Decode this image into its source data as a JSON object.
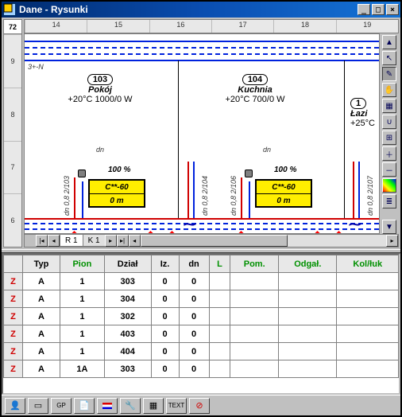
{
  "title": "Dane - Rysunki",
  "topruler_start_label": "72",
  "topruler": [
    "14",
    "15",
    "16",
    "17",
    "18",
    "19"
  ],
  "leftruler": [
    "9",
    "8",
    "7",
    "6"
  ],
  "wall_label": "3+-N",
  "rooms": [
    {
      "num": "103",
      "name": "Pokój",
      "cond": "+20°C 1000/0 W"
    },
    {
      "num": "104",
      "name": "Kuchnia",
      "cond": "+20°C 700/0 W"
    },
    {
      "num": "1",
      "name": "Łazi",
      "cond": "+25°C "
    }
  ],
  "dn_label": "dn",
  "pct_label": "100 %",
  "radiator": {
    "model": "C**-60",
    "len": "0 m"
  },
  "vlabels": [
    "dn 0,8  2/103",
    "dn 0,8  2/104",
    "dn 0,8  2/106",
    "dn 0,8  2/107"
  ],
  "sheet_tabs": [
    "R 1",
    "K 1"
  ],
  "table": {
    "headers": [
      "",
      "Typ",
      "Pion",
      "Dział",
      "Iz.",
      "dn",
      "L",
      "Pom.",
      "Odgał.",
      "Kol/łuk"
    ],
    "green_cols": [
      2,
      6,
      7,
      8,
      9
    ],
    "rows": [
      [
        "Z",
        "A",
        "1",
        "303",
        "0",
        "0",
        "",
        "",
        "",
        ""
      ],
      [
        "Z",
        "A",
        "1",
        "304",
        "0",
        "0",
        "",
        "",
        "",
        ""
      ],
      [
        "Z",
        "A",
        "1",
        "302",
        "0",
        "0",
        "",
        "",
        "",
        ""
      ],
      [
        "Z",
        "A",
        "1",
        "403",
        "0",
        "0",
        "",
        "",
        "",
        ""
      ],
      [
        "Z",
        "A",
        "1",
        "404",
        "0",
        "0",
        "",
        "",
        "",
        ""
      ],
      [
        "Z",
        "A",
        "1A",
        "303",
        "0",
        "0",
        "",
        "",
        "",
        ""
      ]
    ]
  },
  "bottom_icons": [
    "person",
    "rect",
    "gp",
    "note",
    "flag",
    "pipe",
    "table",
    "text",
    "stop"
  ]
}
